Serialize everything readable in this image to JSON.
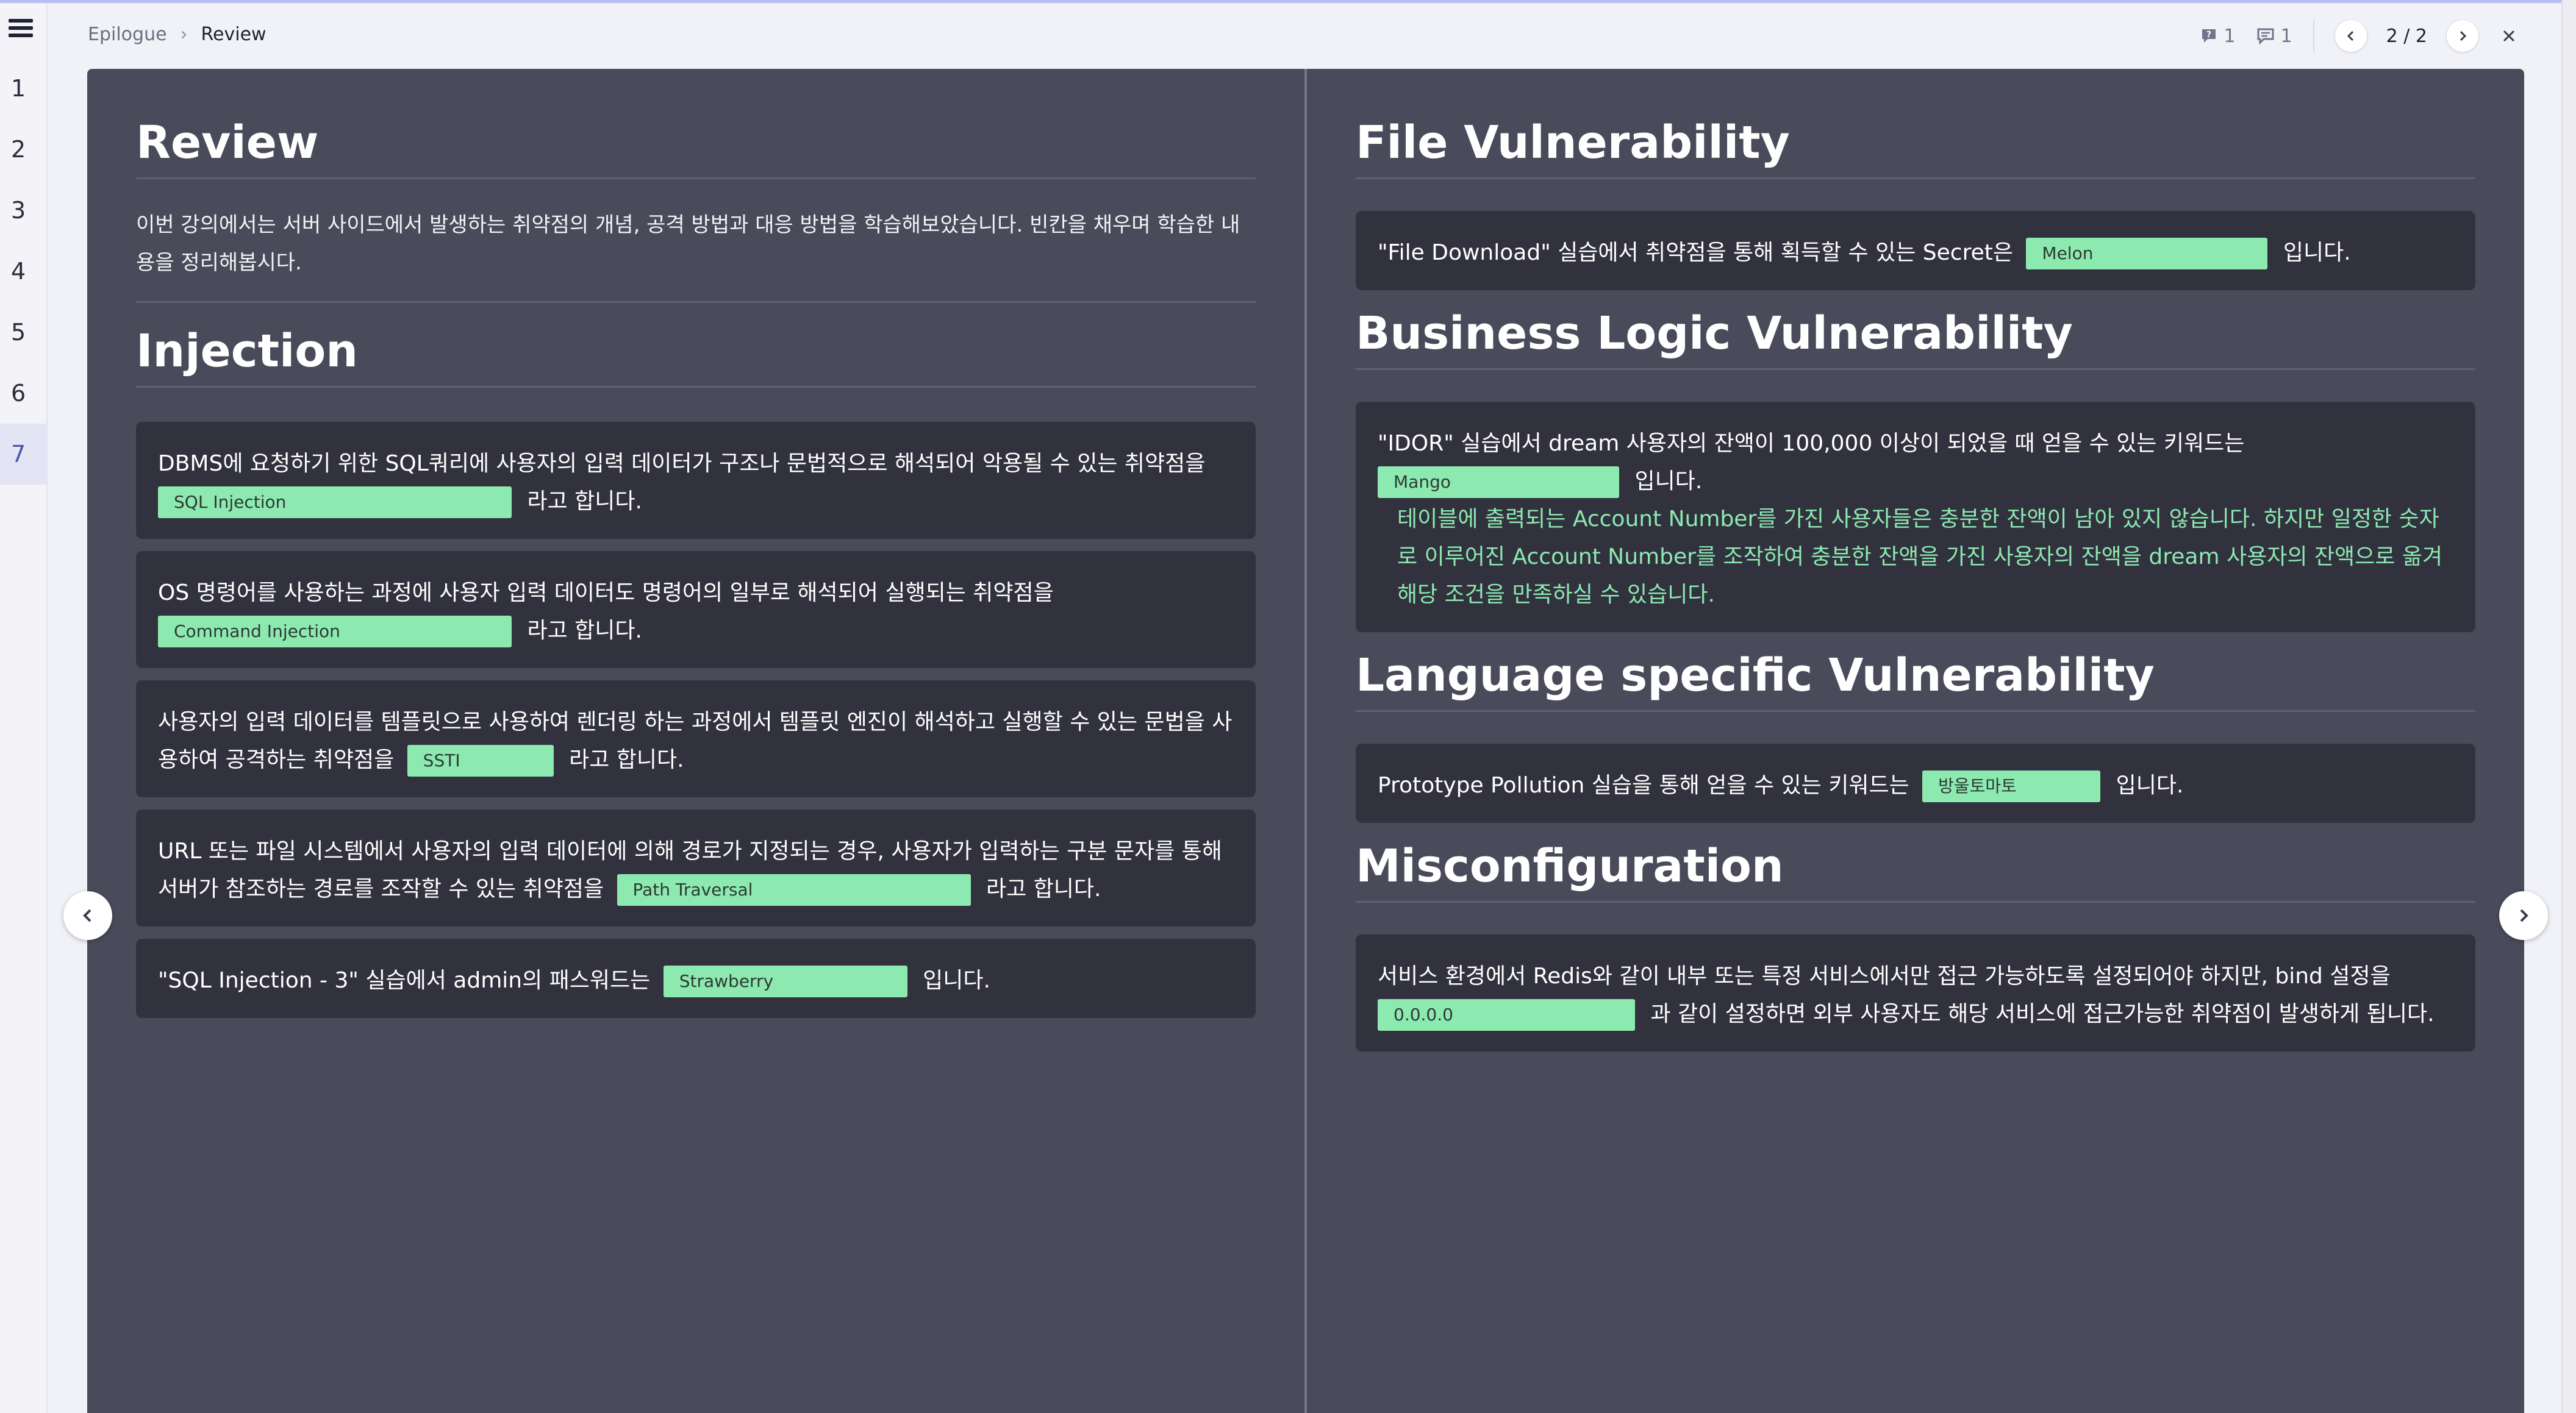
{
  "breadcrumb": {
    "parent": "Epilogue",
    "current": "Review"
  },
  "header": {
    "question_count": "1",
    "comment_count": "1",
    "page_indicator": "2 / 2"
  },
  "rail": {
    "items": [
      "1",
      "2",
      "3",
      "4",
      "5",
      "6",
      "7"
    ],
    "active_index": 6
  },
  "left": {
    "review_title": "Review",
    "intro": "이번 강의에서는 서버 사이드에서 발생하는 취약점의 개념, 공격 방법과 대응 방법을 학습해보았습니다. 빈칸을 채우며 학습한 내용을 정리해봅시다.",
    "injection_title": "Injection",
    "cards": [
      {
        "pre": "DBMS에 요청하기 위한 SQL쿼리에 사용자의 입력 데이터가 구조나 문법적으로 해석되어 악용될 수 있는 취약점을",
        "answer": "SQL Injection",
        "post": "라고 합니다."
      },
      {
        "pre": "OS 명령어를 사용하는 과정에 사용자 입력 데이터도 명령어의 일부로 해석되어 실행되는 취약점을",
        "answer": "Command Injection",
        "post": "라고 합니다."
      },
      {
        "pre": "사용자의 입력 데이터를 템플릿으로 사용하여 렌더링 하는 과정에서 템플릿 엔진이 해석하고 실행할 수 있는 문법을 사용하여 공격하는 취약점을",
        "answer": "SSTI",
        "post": "라고 합니다."
      },
      {
        "pre": "URL 또는 파일 시스템에서 사용자의 입력 데이터에 의해 경로가 지정되는 경우, 사용자가 입력하는 구분 문자를 통해 서버가 참조하는 경로를 조작할 수 있는 취약점을",
        "answer": "Path Traversal",
        "post": "라고 합니다."
      },
      {
        "pre": "\"SQL Injection - 3\" 실습에서 admin의 패스워드는",
        "answer": "Strawberry",
        "post": "입니다."
      }
    ]
  },
  "right": {
    "file_title": "File Vulnerability",
    "file_card": {
      "pre": "\"File Download\" 실습에서 취약점을 통해 획득할 수 있는 Secret은",
      "answer": "Melon",
      "post": "입니다."
    },
    "business_title": "Business Logic Vulnerability",
    "business_card": {
      "pre": "\"IDOR\" 실습에서 dream 사용자의 잔액이 100,000 이상이 되었을 때 얻을 수 있는 키워드는",
      "answer": "Mango",
      "post": "입니다.",
      "hint": "테이블에 출력되는 Account Number를 가진 사용자들은 충분한 잔액이 남아 있지 않습니다. 하지만 일정한 숫자로 이루어진 Account Number를 조작하여 충분한 잔액을 가진 사용자의 잔액을 dream 사용자의 잔액으로 옮겨 해당 조건을 만족하실 수 있습니다."
    },
    "language_title": "Language specific Vulnerability",
    "language_card": {
      "pre": "Prototype Pollution 실습을 통해 얻을 수 있는 키워드는",
      "answer": "방울토마토",
      "post": "입니다."
    },
    "misconfig_title": "Misconfiguration",
    "misconfig_card": {
      "pre": "서비스 환경에서 Redis와 같이 내부 또는 특정 서비스에서만 접근 가능하도록 설정되어야 하지만, bind 설정을",
      "answer": "0.0.0.0",
      "post": "과 같이 설정하면 외부 사용자도 해당 서비스에 접근가능한 취약점이 발생하게 됩니다."
    }
  },
  "colors": {
    "slide_bg": "#4a4b5a",
    "card_bg": "#32323f",
    "answer_bg": "#8ce9b0",
    "hint_text": "#8ce9b0",
    "active_rail": "#4c56a9"
  },
  "icons": {
    "menu": "hamburger-icon",
    "question": "question-bubble-icon",
    "comment": "comment-bubble-icon",
    "prev": "chevron-left-icon",
    "next": "chevron-right-icon",
    "close": "close-icon"
  }
}
